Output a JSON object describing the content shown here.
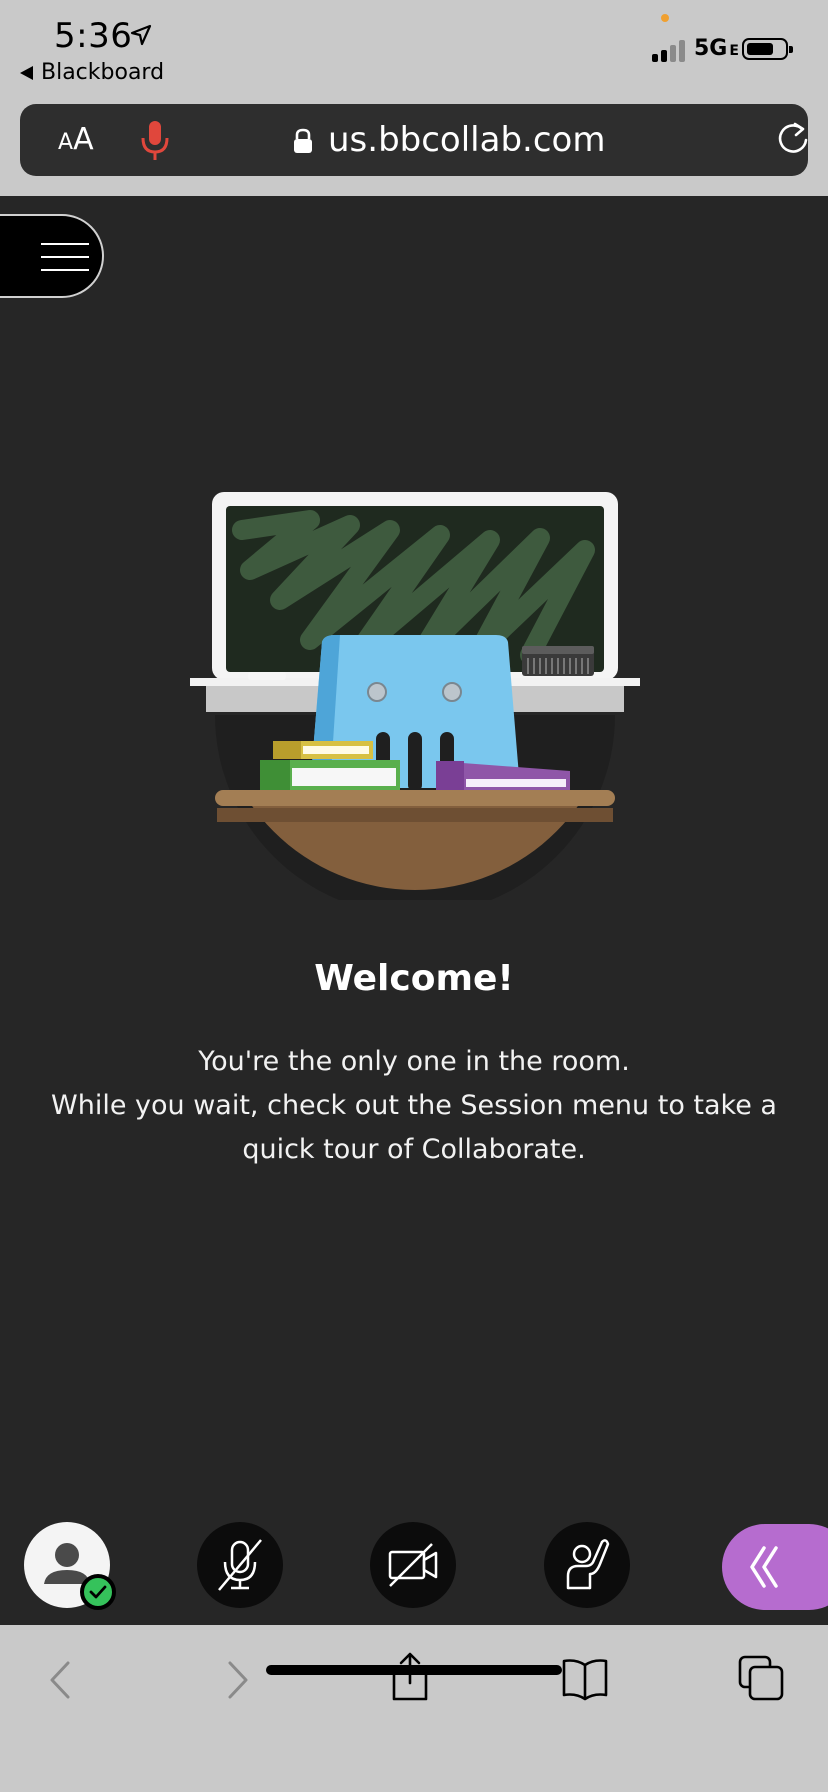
{
  "status_bar": {
    "time": "5:36",
    "back_label": "Blackboard",
    "network": "5G",
    "network_suffix": "E"
  },
  "browser": {
    "text_size_small": "A",
    "text_size_large": "A",
    "url": "us.bbcollab.com"
  },
  "welcome": {
    "title": "Welcome!",
    "line1": "You're the only one in the room.",
    "line2": "While you wait, check out the Session menu to take a quick tour of Collaborate."
  },
  "icons": {
    "location": "location-arrow-icon",
    "microphone": "microphone-icon",
    "lock": "lock-icon",
    "reload": "reload-icon",
    "menu": "hamburger-menu-icon",
    "avatar": "user-avatar-icon",
    "status": "checkmark-icon",
    "mic_off": "microphone-off-icon",
    "camera_off": "camera-off-icon",
    "hand": "raise-hand-icon",
    "panel": "double-chevron-left-icon",
    "back": "chevron-left-icon",
    "forward": "chevron-right-icon",
    "share": "share-icon",
    "bookmarks": "book-icon",
    "tabs": "tabs-icon"
  },
  "colors": {
    "background": "#262626",
    "browser_chrome": "#c9c9c9",
    "url_bar": "#2e2e2e",
    "mic_red": "#e0473c",
    "accent_purple": "#b66ccf",
    "status_green": "#35c25b"
  }
}
